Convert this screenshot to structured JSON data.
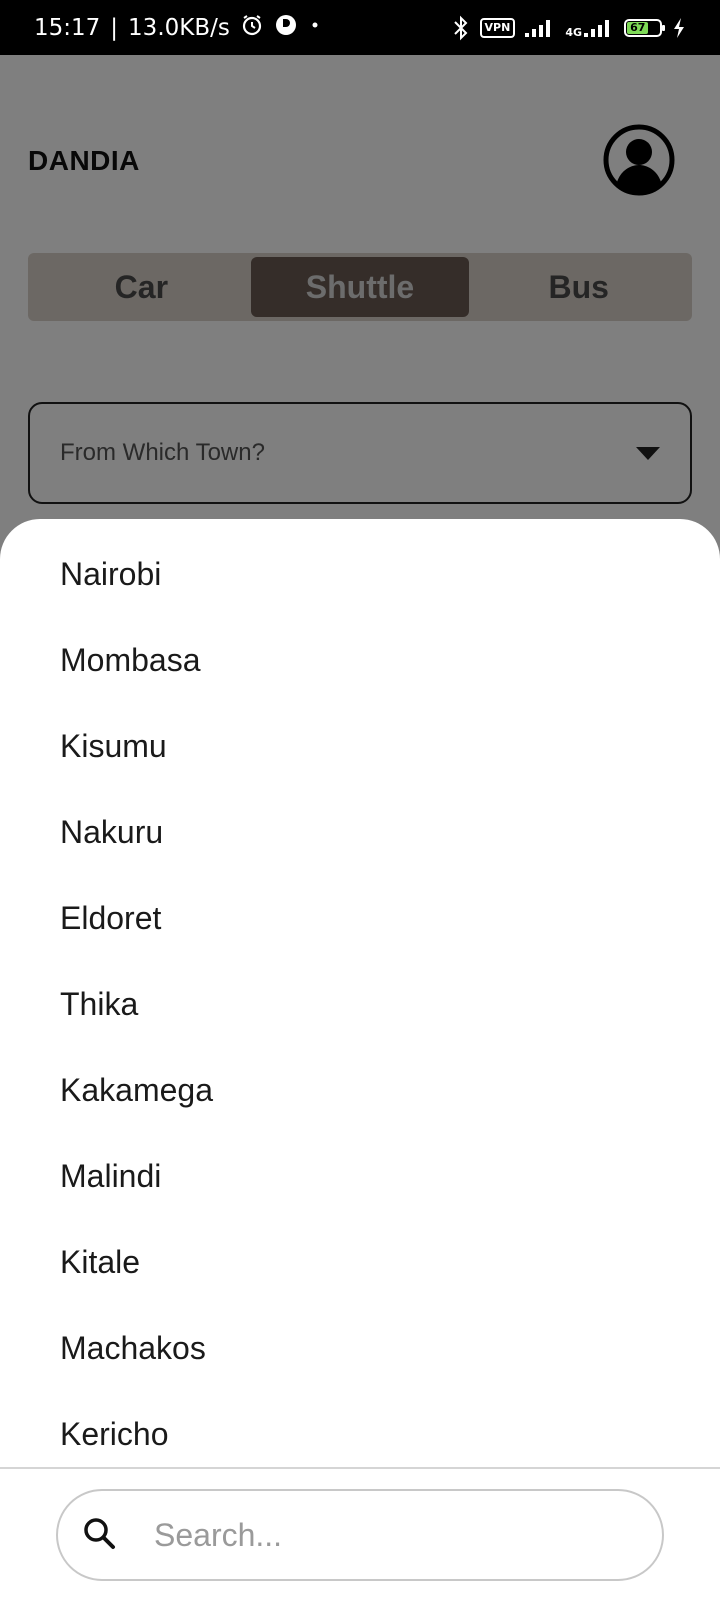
{
  "status_bar": {
    "time": "15:17",
    "speed": "13.0KB/s",
    "vpn": "VPN",
    "network_type": "4G",
    "battery": "67",
    "icons": [
      "alarm-icon",
      "app-notification-icon",
      "dot-icon",
      "bluetooth-icon",
      "vpn-icon",
      "signal-icon",
      "signal-4g-icon",
      "battery-icon",
      "charging-icon"
    ]
  },
  "header": {
    "title": "DANDIA",
    "avatar_icon": "account-circle-icon"
  },
  "tabs": [
    {
      "label": "Car",
      "active": false
    },
    {
      "label": "Shuttle",
      "active": true
    },
    {
      "label": "Bus",
      "active": false
    }
  ],
  "from_dropdown": {
    "placeholder": "From Which Town?",
    "icon": "dropdown-arrow-icon"
  },
  "sheet": {
    "towns": [
      "Nairobi",
      "Mombasa",
      "Kisumu",
      "Nakuru",
      "Eldoret",
      "Thika",
      "Kakamega",
      "Malindi",
      "Kitale",
      "Machakos",
      "Kericho"
    ],
    "search": {
      "placeholder": "Search...",
      "value": "",
      "icon": "search-icon"
    }
  },
  "colors": {
    "active_tab": "#6a5a52",
    "tab_track": "#d8d0c8",
    "scrim": "rgba(0,0,0,0.5)"
  }
}
